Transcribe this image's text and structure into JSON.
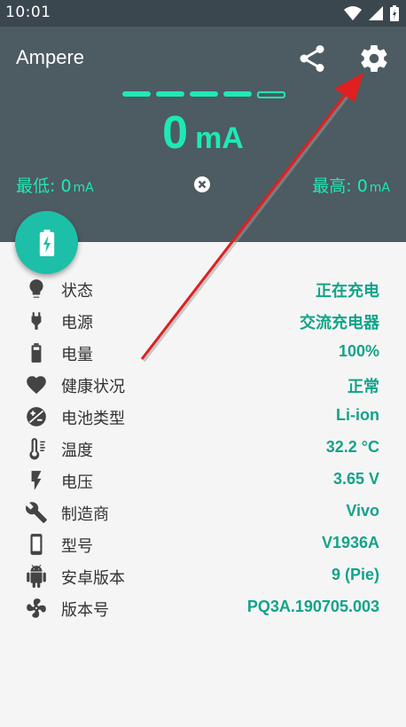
{
  "statusbar": {
    "time": "10:01"
  },
  "header": {
    "title": "Ampere",
    "current_value": "0",
    "current_unit": "mA",
    "min_label": "最低:",
    "min_value": "0",
    "min_unit": "mA",
    "max_label": "最高:",
    "max_value": "0",
    "max_unit": "mA",
    "level_segments_filled": 4,
    "level_segments_total": 5
  },
  "colors": {
    "header_bg": "#4d5b62",
    "accent": "#1de9b6",
    "value_text": "#12a38a",
    "fab": "#1dbfa8",
    "arrow": "#e02020"
  },
  "icons": {
    "share": "share-icon",
    "settings": "gear-icon",
    "reset": "close-circle-icon",
    "fab": "battery-charging-icon"
  },
  "rows": [
    {
      "label": "状态",
      "value": "正在充电",
      "icon": "lightbulb-icon"
    },
    {
      "label": "电源",
      "value": "交流充电器",
      "icon": "plug-icon"
    },
    {
      "label": "电量",
      "value": "100%",
      "icon": "battery-icon"
    },
    {
      "label": "健康状况",
      "value": "正常",
      "icon": "heart-icon"
    },
    {
      "label": "电池类型",
      "value": "Li-ion",
      "icon": "exposure-icon"
    },
    {
      "label": "温度",
      "value": "32.2 °C",
      "icon": "thermometer-icon"
    },
    {
      "label": "电压",
      "value": "3.65 V",
      "icon": "flash-icon"
    },
    {
      "label": "制造商",
      "value": "Vivo",
      "icon": "wrench-icon"
    },
    {
      "label": "型号",
      "value": "V1936A",
      "icon": "phone-icon"
    },
    {
      "label": "安卓版本",
      "value": "9 (Pie)",
      "icon": "android-icon"
    },
    {
      "label": "版本号",
      "value": "PQ3A.190705.003",
      "icon": "fan-icon"
    }
  ]
}
